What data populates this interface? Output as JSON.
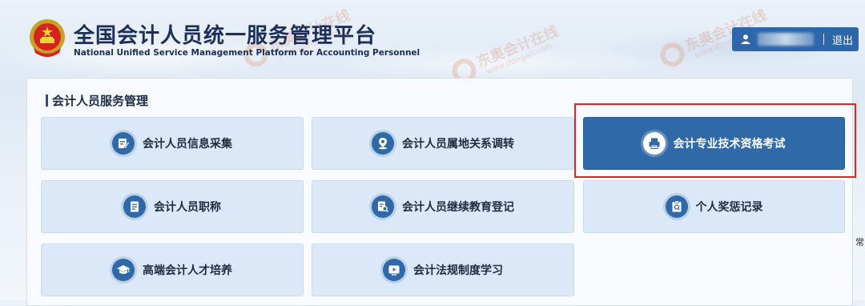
{
  "header": {
    "title_cn": "全国会计人员统一服务管理平台",
    "title_en": "National Unified Service Management Platform for Accounting Personnel",
    "logout_label": "退出",
    "user_icon": "user-icon"
  },
  "section": {
    "title": "会计人员服务管理"
  },
  "tiles": [
    {
      "label": "会计人员信息采集",
      "icon": "edit-form-icon"
    },
    {
      "label": "会计人员属地关系调转",
      "icon": "location-pin-icon"
    },
    {
      "label": "会计专业技术资格考试",
      "icon": "exam-printer-icon",
      "selected": true
    },
    {
      "label": "会计人员职称",
      "icon": "document-icon"
    },
    {
      "label": "会计人员继续教育登记",
      "icon": "search-document-icon"
    },
    {
      "label": "个人奖惩记录",
      "icon": "record-book-icon"
    },
    {
      "label": "高端会计人才培养",
      "icon": "graduation-cap-icon"
    },
    {
      "label": "会计法规制度学习",
      "icon": "video-play-icon"
    }
  ],
  "side_text": "常",
  "watermark": {
    "cn": "东奥会计在线",
    "en": "www.dongao.com"
  },
  "colors": {
    "primary": "#2f69a8",
    "tile_bg": "#dbe8f7",
    "highlight": "#e0271f"
  }
}
